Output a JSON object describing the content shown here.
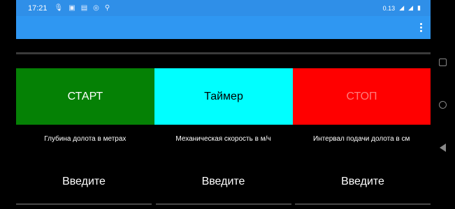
{
  "status_bar": {
    "time": "17:21",
    "icons": [
      "mic-icon",
      "image-icon",
      "cast-icon",
      "vpn-icon",
      "search-icon"
    ],
    "net_speed": "0.13",
    "right_icons": [
      "signal-icon",
      "wifi-icon",
      "battery-icon"
    ],
    "color": "#2f8fe8"
  },
  "app_bar": {
    "color": "#2f97f2",
    "menu_icon": "more-vert-icon"
  },
  "buttons": {
    "start": {
      "label": "СТАРТ",
      "color": "#058105"
    },
    "timer": {
      "label": "Таймер",
      "color": "#00ffff"
    },
    "stop": {
      "label": "СТОП",
      "color": "#ff0000"
    }
  },
  "labels": {
    "depth": "Глубина долота в метрах",
    "speed": "Механическая скорость в м/ч",
    "interval": "Интервал подачи долота в см"
  },
  "inputs": {
    "depth": {
      "placeholder": "Введите",
      "value": ""
    },
    "speed": {
      "placeholder": "Введите",
      "value": ""
    },
    "interval": {
      "placeholder": "Введите",
      "value": ""
    }
  },
  "nav": [
    "recents-icon",
    "home-icon",
    "back-icon"
  ]
}
